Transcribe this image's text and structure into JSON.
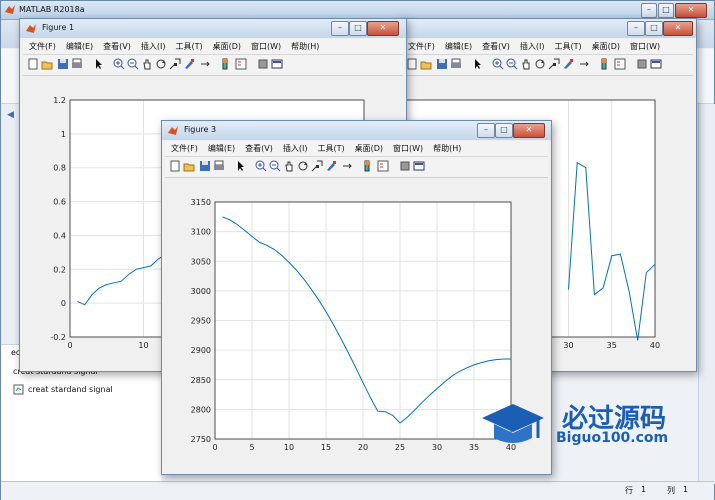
{
  "main": {
    "title": "MATLAB R2018a",
    "bg_tabs": [
      "",
      "",
      "",
      "",
      ""
    ],
    "statusbar": {
      "row_label": "行",
      "row_value": "1",
      "col_label": "列",
      "col_value": "1"
    },
    "workspace_items": [
      {
        "label": "creat stardand signal"
      },
      {
        "label": "creat stardand signal"
      }
    ],
    "side_fragment": "ec"
  },
  "figures": {
    "figure1": {
      "title": "Figure 1"
    },
    "figure2": {
      "title": ""
    },
    "figure3": {
      "title": "Figure 3"
    }
  },
  "menu": [
    "文件(F)",
    "编辑(E)",
    "查看(V)",
    "插入(I)",
    "工具(T)",
    "桌面(D)",
    "窗口(W)",
    "帮助(H)"
  ],
  "toolbar_icons": [
    "new-file-icon",
    "open-file-icon",
    "save-icon",
    "print-icon",
    "arrow-pointer-icon",
    "zoom-in-icon",
    "zoom-out-icon",
    "pan-icon",
    "rotate-icon",
    "data-cursor-icon",
    "brush-icon",
    "link-plot-icon",
    "colorbar-icon",
    "legend-icon",
    "hide-plot-tools-icon",
    "show-plot-tools-icon"
  ],
  "watermark": {
    "text": "必过源码",
    "subtext": "Biguo100.com"
  },
  "chart_data": [
    {
      "type": "line",
      "figure": "Figure 1",
      "x": [
        1,
        2,
        3,
        4,
        5,
        6,
        7,
        8,
        9,
        10,
        11,
        12,
        13
      ],
      "y": [
        0.01,
        -0.01,
        0.05,
        0.09,
        0.11,
        0.12,
        0.13,
        0.17,
        0.2,
        0.21,
        0.22,
        0.26,
        0.29
      ],
      "xlim": [
        0,
        40
      ],
      "ylim": [
        -0.2,
        1.2
      ],
      "xticks": [
        "0",
        "10"
      ],
      "yticks": [
        "-0.2",
        "0",
        "0.2",
        "0.4",
        "0.6",
        "0.8",
        "1",
        "1.2"
      ],
      "color": "#0072bd",
      "grid": true
    },
    {
      "type": "line",
      "figure": "Figure 2",
      "x": [
        30,
        31,
        32,
        33,
        34,
        35,
        36,
        37,
        38,
        39,
        40
      ],
      "y": [
        0.08,
        0.83,
        0.8,
        0.05,
        0.09,
        0.28,
        0.29,
        0.07,
        -0.22,
        0.18,
        0.23
      ],
      "xlim": [
        0,
        40
      ],
      "ylim": [
        -0.2,
        1.2
      ],
      "xticks": [
        "30",
        "35",
        "40"
      ],
      "color": "#0072bd",
      "grid": true
    },
    {
      "type": "line",
      "figure": "Figure 3",
      "x": [
        1,
        2,
        3,
        4,
        5,
        6,
        7,
        8,
        9,
        10,
        11,
        12,
        13,
        14,
        15,
        16,
        17,
        18,
        19,
        20,
        21,
        22,
        23,
        24,
        25,
        26,
        27,
        28,
        29,
        30,
        31,
        32,
        33,
        34,
        35,
        36,
        37,
        38,
        39,
        40
      ],
      "y": [
        3125,
        3120,
        3112,
        3102,
        3092,
        3082,
        3077,
        3070,
        3060,
        3048,
        3035,
        3020,
        3003,
        2985,
        2965,
        2943,
        2920,
        2896,
        2871,
        2845,
        2820,
        2797,
        2796,
        2790,
        2777,
        2787,
        2799,
        2812,
        2824,
        2835,
        2846,
        2856,
        2864,
        2870,
        2875,
        2879,
        2882,
        2884,
        2885,
        2885
      ],
      "xlim": [
        0,
        40
      ],
      "ylim": [
        2750,
        3150
      ],
      "xticks": [
        "0",
        "5",
        "10",
        "15",
        "20",
        "25",
        "30",
        "35",
        "40"
      ],
      "yticks": [
        "2750",
        "2800",
        "2850",
        "2900",
        "2950",
        "3000",
        "3050",
        "3100",
        "3150"
      ],
      "color": "#0072bd",
      "grid": true
    }
  ]
}
